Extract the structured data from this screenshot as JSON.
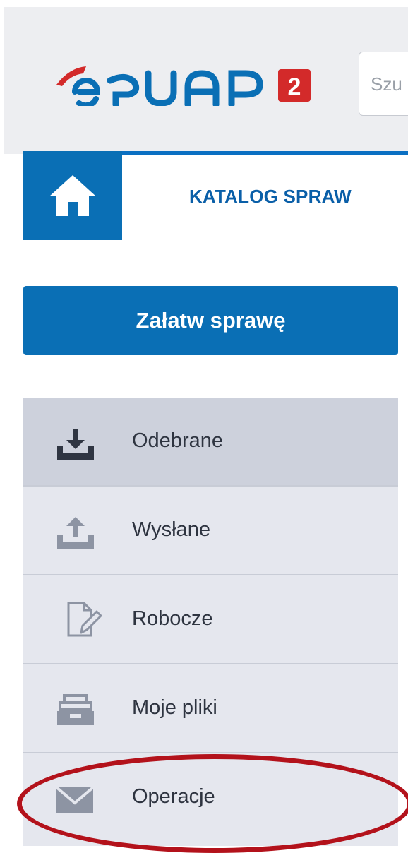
{
  "header": {
    "logo_text": "ePUAP",
    "logo_badge": "2",
    "search_placeholder": "Szu",
    "brand_red": "#d32a2a"
  },
  "top_nav": {
    "home_icon": "home-icon",
    "catalog_label": "KATALOG SPRAW"
  },
  "cta": {
    "label": "Załatw sprawę"
  },
  "sidebar": {
    "items": [
      {
        "label": "Odebrane",
        "icon": "inbox-download-icon",
        "active": true
      },
      {
        "label": "Wysłane",
        "icon": "upload-tray-icon",
        "active": false
      },
      {
        "label": "Robocze",
        "icon": "draft-document-icon",
        "active": false
      },
      {
        "label": "Moje pliki",
        "icon": "file-tray-icon",
        "active": false
      },
      {
        "label": "Operacje",
        "icon": "envelope-icon",
        "active": false
      }
    ]
  },
  "colors": {
    "accent": "#0a6fb5",
    "highlight": "#b3121b"
  }
}
